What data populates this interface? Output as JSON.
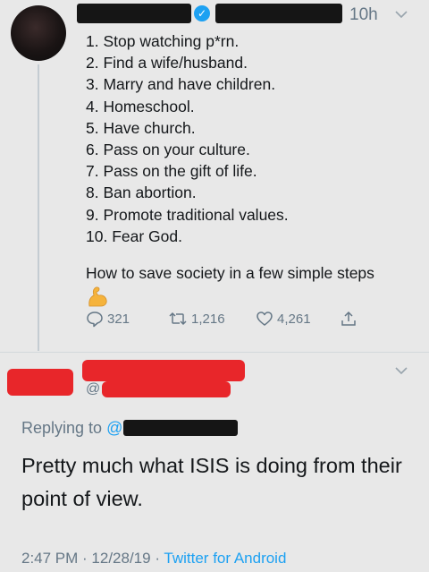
{
  "tweet": {
    "time": "10h",
    "items": [
      "1. Stop watching p*rn.",
      "2. Find a wife/husband.",
      "3. Marry and have children.",
      "4. Homeschool.",
      "5. Have church.",
      "6. Pass on your culture.",
      "7. Pass on the gift of life.",
      "8. Ban abortion.",
      "9. Promote traditional values.",
      "10. Fear God."
    ],
    "tagline": "How to save society in a few simple steps",
    "emoji": "flexed-biceps-icon",
    "actions": {
      "replies": "321",
      "retweets": "1,216",
      "likes": "4,261"
    }
  },
  "reply": {
    "handle_prefix": "@",
    "replying_label": "Replying to",
    "replying_at": "@",
    "text": "Pretty much what ISIS is doing from their point of view.",
    "timestamp": "2:47 PM · 12/28/19 · ",
    "source": "Twitter for Android"
  },
  "colors": {
    "background": "#e8e8e8",
    "accent": "#1da1f2",
    "muted": "#657786",
    "redaction_dark": "#151515",
    "redaction_red": "#e8262a"
  }
}
